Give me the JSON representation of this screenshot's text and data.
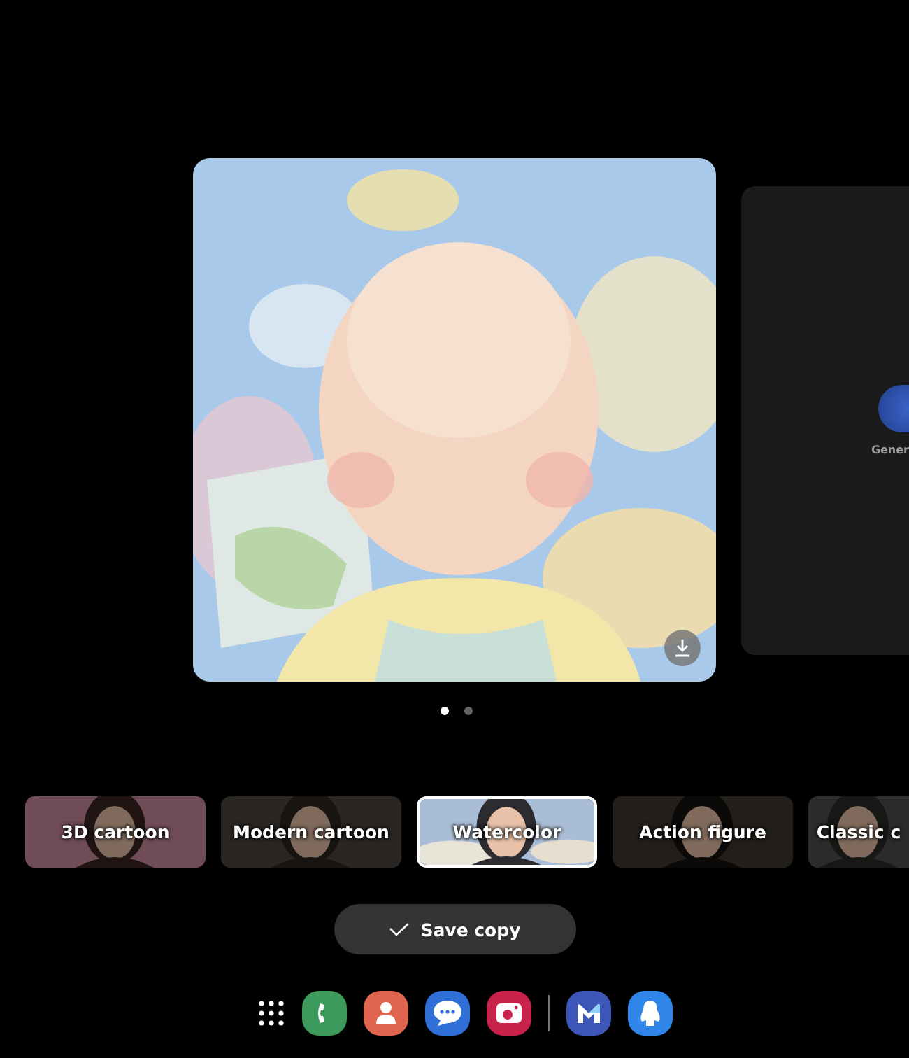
{
  "carousel": [
    {
      "kind": "picture"
    },
    {
      "kind": "generate",
      "label": "Gener"
    }
  ],
  "page_dots": [
    {
      "selected": true
    },
    {
      "selected": false
    }
  ],
  "styles": [
    {
      "label": "3D cartoon",
      "selected": false
    },
    {
      "label": "Modern cartoon",
      "selected": false
    },
    {
      "label": "Watercolor",
      "selected": true
    },
    {
      "label": "Action figure",
      "selected": false
    },
    {
      "label": "Classic c",
      "selected": false
    }
  ],
  "save_button": {
    "label": "Save copy"
  }
}
